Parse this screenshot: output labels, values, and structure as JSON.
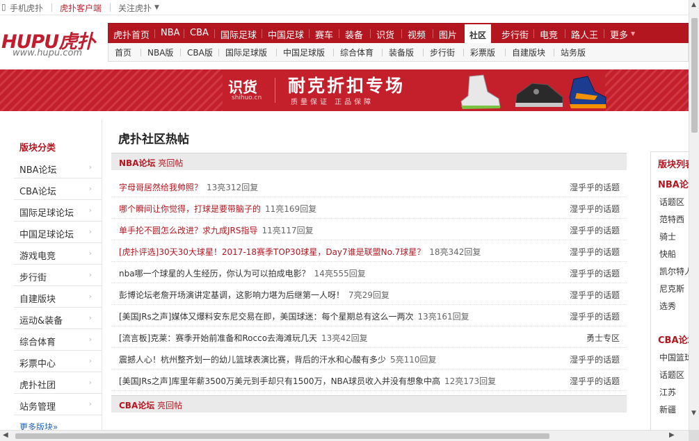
{
  "topbar": {
    "mobile": "手机虎扑",
    "client": "虎扑客户端",
    "follow": "关注虎扑"
  },
  "logo": {
    "brand": "HUPU虎扑",
    "url": "www.hupu.com"
  },
  "mainnav": [
    "虎扑首页",
    "NBA",
    "CBA",
    "国际足球",
    "中国足球",
    "赛车",
    "装备",
    "识货",
    "视频",
    "图片",
    "社区",
    "步行街",
    "电竞",
    "路人王",
    "更多"
  ],
  "mainnav_active": "社区",
  "subnav": [
    "首页",
    "NBA版",
    "CBA版",
    "国际足球版",
    "中国足球版",
    "综合体育",
    "装备版",
    "步行街",
    "彩票版",
    "自建版块",
    "站务版"
  ],
  "banner": {
    "brand": "识货",
    "brand_sub": "shihuo.cn",
    "slogan": "耐克折扣专场",
    "tagline": "质量保证  正品保障"
  },
  "sidebar": {
    "title": "版块分类",
    "items": [
      "NBA论坛",
      "CBA论坛",
      "国际足球论坛",
      "中国足球论坛",
      "游戏电竞",
      "步行街",
      "自建版块",
      "运动&装备",
      "综合体育",
      "彩票中心",
      "虎扑社团",
      "站务管理"
    ],
    "more": "更多版块»"
  },
  "center": {
    "title": "虎扑社区热帖",
    "sections": [
      {
        "forum": "NBA论坛",
        "label": "亮回帖",
        "posts": [
          {
            "title": "字母哥居然给我帅照？",
            "meta": "13亮312回复",
            "source": "湿乎乎的话题",
            "red": true
          },
          {
            "title": "哪个瞬间让你觉得，打球是要带脑子的",
            "meta": "11亮169回复",
            "source": "湿乎乎的话题",
            "red": true
          },
          {
            "title": "单手抡不圆怎么改进？求九成JRS指导",
            "meta": "11亮117回复",
            "source": "湿乎乎的话题",
            "red": true
          },
          {
            "title": "[虎扑评选]30天30大球星！2017-18赛季TOP30球星，Day7谁是联盟No.7球星？",
            "meta": "18亮342回复",
            "source": "湿乎乎的话题",
            "red": true
          },
          {
            "title": "nba哪一个球星的人生经历，你认为可以拍成电影？",
            "meta": "14亮555回复",
            "source": "湿乎乎的话题",
            "red": false
          },
          {
            "title": "彭博论坛老詹开场演讲定基调，这影响力堪为后继第一人呀！",
            "meta": "7亮29回复",
            "source": "湿乎乎的话题",
            "red": false
          },
          {
            "title": "[美国JRs之声]媒体又爆料安东尼交易在即，美国球迷：每个星期总有这么一两次",
            "meta": "13亮161回复",
            "source": "湿乎乎的话题",
            "red": false
          },
          {
            "title": "[流言板]克莱：赛季开始前准备和Rocco去海滩玩几天",
            "meta": "13亮42回复",
            "source": "勇士专区",
            "red": false
          },
          {
            "title": "震撼人心！杭州整齐划一的幼儿篮球表演比赛，背后的汗水和心酸有多少",
            "meta": "5亮110回复",
            "source": "湿乎乎的话题",
            "red": false
          },
          {
            "title": "[美国JRs之声]库里年薪3500万美元到手却只有1500万，NBA球员收入并没有想象中高",
            "meta": "12亮173回复",
            "source": "湿乎乎的话题",
            "red": false
          }
        ]
      },
      {
        "forum": "CBA论坛",
        "label": "亮回帖",
        "posts": []
      }
    ]
  },
  "right": {
    "title": "版块列表",
    "groups": [
      {
        "name": "NBA论坛",
        "items": [
          "话题区",
          "范特西",
          "骑士",
          "快船",
          "凯尔特人",
          "尼克斯",
          "选秀"
        ]
      },
      {
        "name": "CBA论坛",
        "items": [
          "中国篮球",
          "话题区",
          "江苏",
          "新疆"
        ]
      }
    ]
  },
  "colors": {
    "brand_red": "#b4161f",
    "link_blue": "#2266bb"
  }
}
